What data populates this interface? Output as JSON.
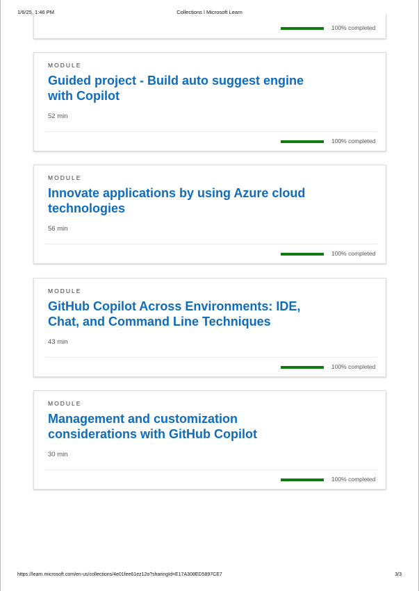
{
  "header": {
    "datetime": "1/6/25, 1:46 PM",
    "doc_title": "Collections | Microsoft Learn"
  },
  "footer": {
    "url": "https://learn.microsoft.com/en-us/collections/4e01fee61ez12o?sharingId=E17A308ED5897CE7",
    "page": "3/3"
  },
  "partial_card": {
    "progress": 1.0,
    "status": "100% completed"
  },
  "modules": [
    {
      "label": "MODULE",
      "title": "Guided project - Build auto suggest engine with Copilot",
      "duration": "52 min",
      "progress": 1.0,
      "status": "100% completed"
    },
    {
      "label": "MODULE",
      "title": "Innovate applications by using Azure cloud technologies",
      "duration": "56 min",
      "progress": 1.0,
      "status": "100% completed"
    },
    {
      "label": "MODULE",
      "title": "GitHub Copilot Across Environments: IDE, Chat, and Command Line Techniques",
      "duration": "43 min",
      "progress": 1.0,
      "status": "100% completed"
    },
    {
      "label": "MODULE",
      "title": "Management and customization considerations with GitHub Copilot",
      "duration": "30 min",
      "progress": 1.0,
      "status": "100% completed"
    }
  ]
}
